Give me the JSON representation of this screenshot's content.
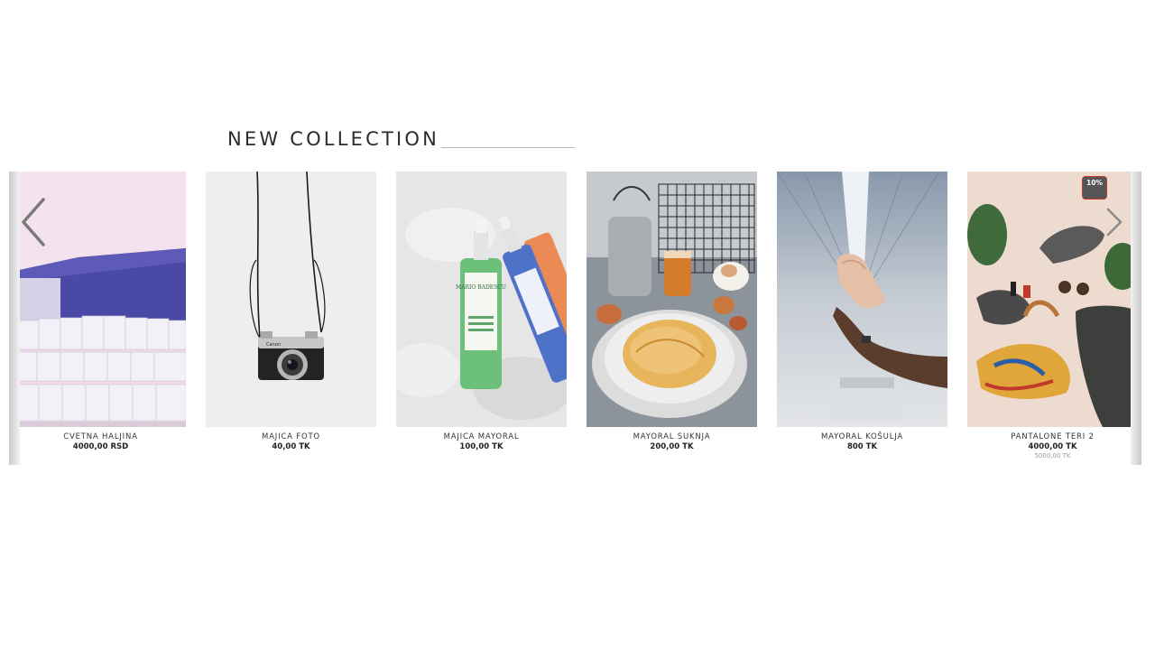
{
  "section": {
    "title": "NEW COLLECTION"
  },
  "carousel": {
    "prev_icon": "chevron-left-icon",
    "next_icon": "chevron-right-icon",
    "products": [
      {
        "name": "CVETNA HALJINA",
        "price": "4000,00 RSD"
      },
      {
        "name": "MAJICA FOTO",
        "price": "40,00 TK"
      },
      {
        "name": "MAJICA MAYORAL",
        "price": "100,00 TK"
      },
      {
        "name": "MAYORAL SUKNJA",
        "price": "200,00 TK"
      },
      {
        "name": "MAYORAL KOŠULJA",
        "price": "800 TK"
      },
      {
        "name": "PANTALONE TERI 2",
        "price": "4000,00 TK",
        "old_price": "5000,00 TK",
        "badge": "10%"
      }
    ]
  },
  "image_labels": {
    "bottle_brand": "MARIO BADESCU",
    "camera_brand": "Canon"
  }
}
